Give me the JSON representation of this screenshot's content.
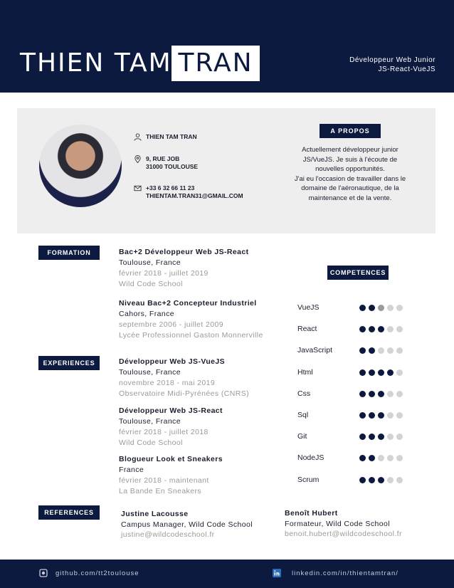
{
  "header": {
    "first_name": "THIEN TAM",
    "last_name": "TRAN",
    "job_line1": "Développeur Web Junior",
    "job_line2": "JS-React-VueJS"
  },
  "contact": {
    "name": "THIEN TAM TRAN",
    "address_line1": "9, RUE JOB",
    "address_line2": "31000 TOULOUSE",
    "phone": "+33 6 32 66 11 23",
    "email": "THIENTAM.TRAN31@GMAIL.COM"
  },
  "about": {
    "title": "A PROPOS",
    "text": "Actuellement développeur junior\nJS/VueJS. Je suis à l'écoute de\nnouvelles opportunités.\nJ'ai eu l'occasion de travailler dans le\ndomaine de l'aéronautique, de la\nmaintenance et de la vente."
  },
  "formation": {
    "title": "FORMATION",
    "items": [
      {
        "title": "Bac+2 Développeur Web JS-React",
        "place": "Toulouse, France",
        "dates": "février 2018 - juillet 2019",
        "school": "Wild Code School"
      },
      {
        "title": "Niveau Bac+2 Concepteur Industriel",
        "place": "Cahors, France",
        "dates": "septembre 2006 - juillet 2009",
        "school": "Lycée Professionnel Gaston Monnerville"
      }
    ]
  },
  "experiences": {
    "title": "EXPERIENCES",
    "items": [
      {
        "title": "Développeur Web JS-VueJS",
        "place": "Toulouse, France",
        "dates": "novembre 2018 - mai 2019",
        "company": "Observatoire Midi-Pyrénées (CNRS)"
      },
      {
        "title": "Développeur Web JS-React",
        "place": "Toulouse, France",
        "dates": "février 2018 - juillet 2018",
        "company": "Wild Code School"
      },
      {
        "title": "Blogueur Look et Sneakers",
        "place": "France",
        "dates": "février 2018 - maintenant",
        "company": "La Bande En Sneakers"
      }
    ]
  },
  "competences": {
    "title": "COMPETENCES",
    "items": [
      {
        "name": "VueJS",
        "level": 2.5
      },
      {
        "name": "React",
        "level": 3
      },
      {
        "name": "JavaScript",
        "level": 2
      },
      {
        "name": "Html",
        "level": 4
      },
      {
        "name": "Css",
        "level": 3
      },
      {
        "name": "Sql",
        "level": 3
      },
      {
        "name": "Git",
        "level": 3
      },
      {
        "name": "NodeJS",
        "level": 2
      },
      {
        "name": "Scrum",
        "level": 3
      }
    ],
    "max": 5
  },
  "references": {
    "title": "REFERENCES",
    "items": [
      {
        "name": "Justine Lacousse",
        "role": "Campus Manager, Wild Code School",
        "email": "justine@wildcodeschool.fr"
      },
      {
        "name": "Benoît Hubert",
        "role": "Formateur, Wild Code School",
        "email": "benoit.hubert@wildcodeschool.fr"
      }
    ]
  },
  "footer": {
    "github": "github.com/tt2toulouse",
    "linkedin": "linkedin.com/in/thientamtran/"
  },
  "colors": {
    "navy": "#0d1a3f",
    "panel": "#eeeeee",
    "muted": "#9a9a9a"
  }
}
